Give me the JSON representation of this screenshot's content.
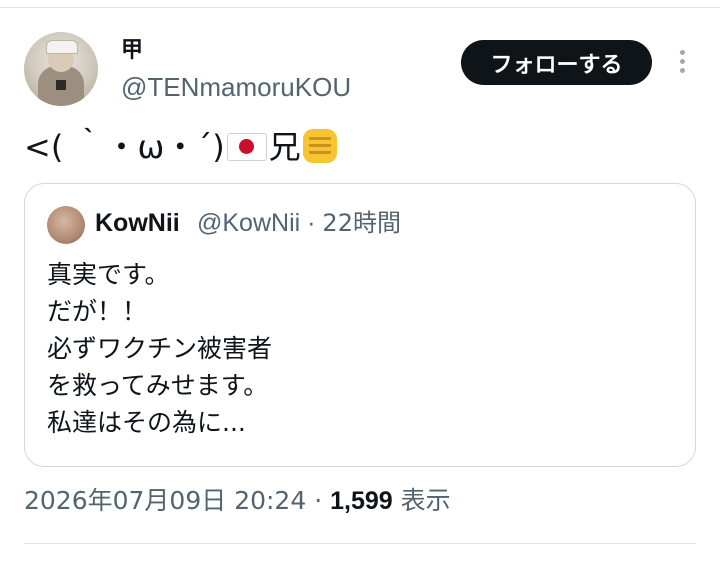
{
  "tweet": {
    "author": {
      "display_name": "甲",
      "handle": "@TENmamoruKOU"
    },
    "follow_label": "フォローする",
    "more_icon": "more-vertical-icon",
    "text": {
      "face": "<( ｀・ω・´)",
      "flag_icon": "japan-flag-emoji",
      "word": "兄",
      "fist_icon": "raised-fist-emoji"
    },
    "quote": {
      "author_name": "KowNii",
      "author_handle": "@KowNii",
      "separator": "·",
      "time": "22時間",
      "lines": [
        "真実です。",
        "だが！！",
        "必ずワクチン被害者",
        "を救ってみせます。",
        "私達はその為に..."
      ]
    },
    "footer": {
      "timestamp": "2026年07月09日 20:24",
      "separator": "·",
      "views": "1,599",
      "views_label": "表示"
    }
  },
  "colors": {
    "primary_text": "#0f1419",
    "secondary_text": "#536471",
    "button_bg": "#0f1419",
    "border": "#cfd9de"
  }
}
